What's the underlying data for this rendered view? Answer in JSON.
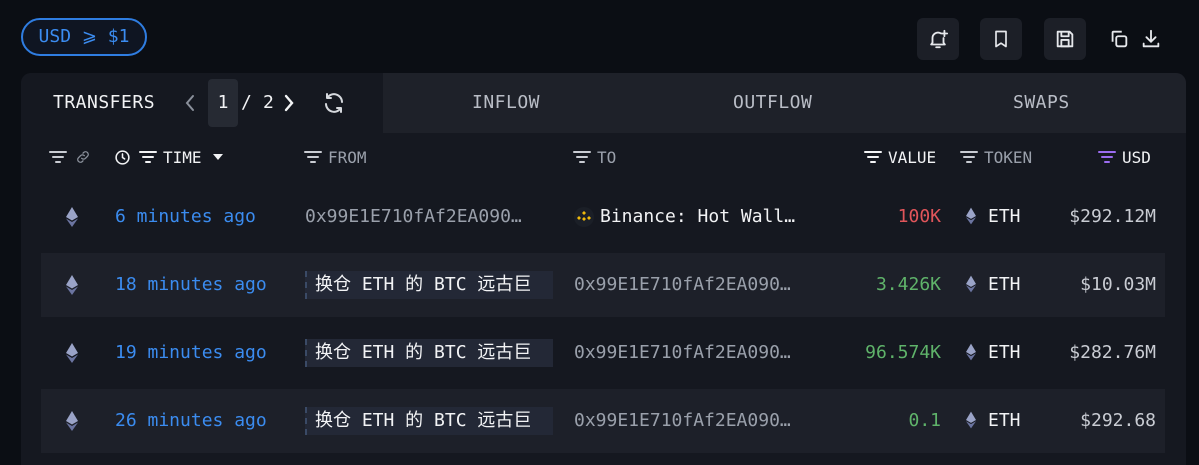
{
  "filter": {
    "label": "USD ⩾ $1"
  },
  "toolbar": {
    "icons": [
      "bell-plus-icon",
      "bookmark-icon",
      "save-icon",
      "copy-icon",
      "download-icon"
    ]
  },
  "tabs": {
    "transfers": "TRANSFERS",
    "inflow": "INFLOW",
    "outflow": "OUTFLOW",
    "swaps": "SWAPS"
  },
  "pager": {
    "current": "1",
    "separator": "/",
    "total": "2"
  },
  "columns": {
    "time": "TIME",
    "from": "FROM",
    "to": "TO",
    "value": "VALUE",
    "token": "TOKEN",
    "usd": "USD"
  },
  "colors": {
    "accent": "#3b8cf0",
    "negative": "#e0555a",
    "positive": "#5fb36a",
    "usd_filter": "#9b6cf0"
  },
  "rows": [
    {
      "time": "6 minutes ago",
      "from": "0x99E1E710fAf2EA090…",
      "to": "Binance: Hot Wall…",
      "to_icon": "binance-icon",
      "value": "100K",
      "value_color": "red",
      "token": "ETH",
      "usd": "$292.12M"
    },
    {
      "time": "18 minutes ago",
      "from": "换仓 ETH 的 BTC 远古巨",
      "to": "0x99E1E710fAf2EA090…",
      "value": "3.426K",
      "value_color": "green",
      "token": "ETH",
      "usd": "$10.03M"
    },
    {
      "time": "19 minutes ago",
      "from": "换仓 ETH 的 BTC 远古巨",
      "to": "0x99E1E710fAf2EA090…",
      "value": "96.574K",
      "value_color": "green",
      "token": "ETH",
      "usd": "$282.76M"
    },
    {
      "time": "26 minutes ago",
      "from": "换仓 ETH 的 BTC 远古巨",
      "to": "0x99E1E710fAf2EA090…",
      "value": "0.1",
      "value_color": "green",
      "token": "ETH",
      "usd": "$292.68"
    }
  ]
}
